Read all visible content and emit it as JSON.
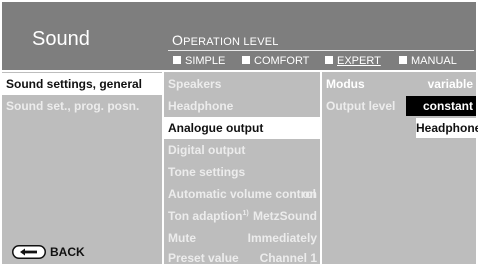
{
  "header": {
    "title": "Sound",
    "operation_level_first": "O",
    "operation_level_rest": "PERATION LEVEL",
    "levels": [
      {
        "label": "SIMPLE",
        "selected": false
      },
      {
        "label": "COMFORT",
        "selected": false
      },
      {
        "label": "EXPERT",
        "selected": true
      },
      {
        "label": "MANUAL",
        "selected": false
      }
    ]
  },
  "menu": {
    "items": [
      {
        "label": "Sound settings, general",
        "active": true
      },
      {
        "label": "Sound set., prog. posn.",
        "active": false
      }
    ]
  },
  "submenu": {
    "items": [
      {
        "label": "Speakers",
        "value": ""
      },
      {
        "label": "Headphone",
        "value": ""
      },
      {
        "label": "Analogue output",
        "value": "",
        "active": true
      },
      {
        "label": "Digital output",
        "value": ""
      },
      {
        "label": "Tone settings",
        "value": ""
      },
      {
        "label": "Automatic volume control",
        "value": "on"
      },
      {
        "label": "Ton adaption",
        "footnote": "1)",
        "value": "MetzSound"
      },
      {
        "label": "Mute",
        "value": "Immediately"
      },
      {
        "label": "Preset value",
        "value": "Channel 1"
      }
    ]
  },
  "settings": {
    "modus_label": "Modus",
    "modus_value": "variable",
    "output_level_label": "Output level",
    "options": [
      "constant",
      "Headphone"
    ]
  },
  "footer": {
    "back_label": "BACK",
    "back_icon": "back-button-icon"
  },
  "colors": {
    "header_bg": "#7e7e7e",
    "panel_bg": "#bdbdbd",
    "highlight": "#ffffff",
    "selected_option": "#000000"
  }
}
